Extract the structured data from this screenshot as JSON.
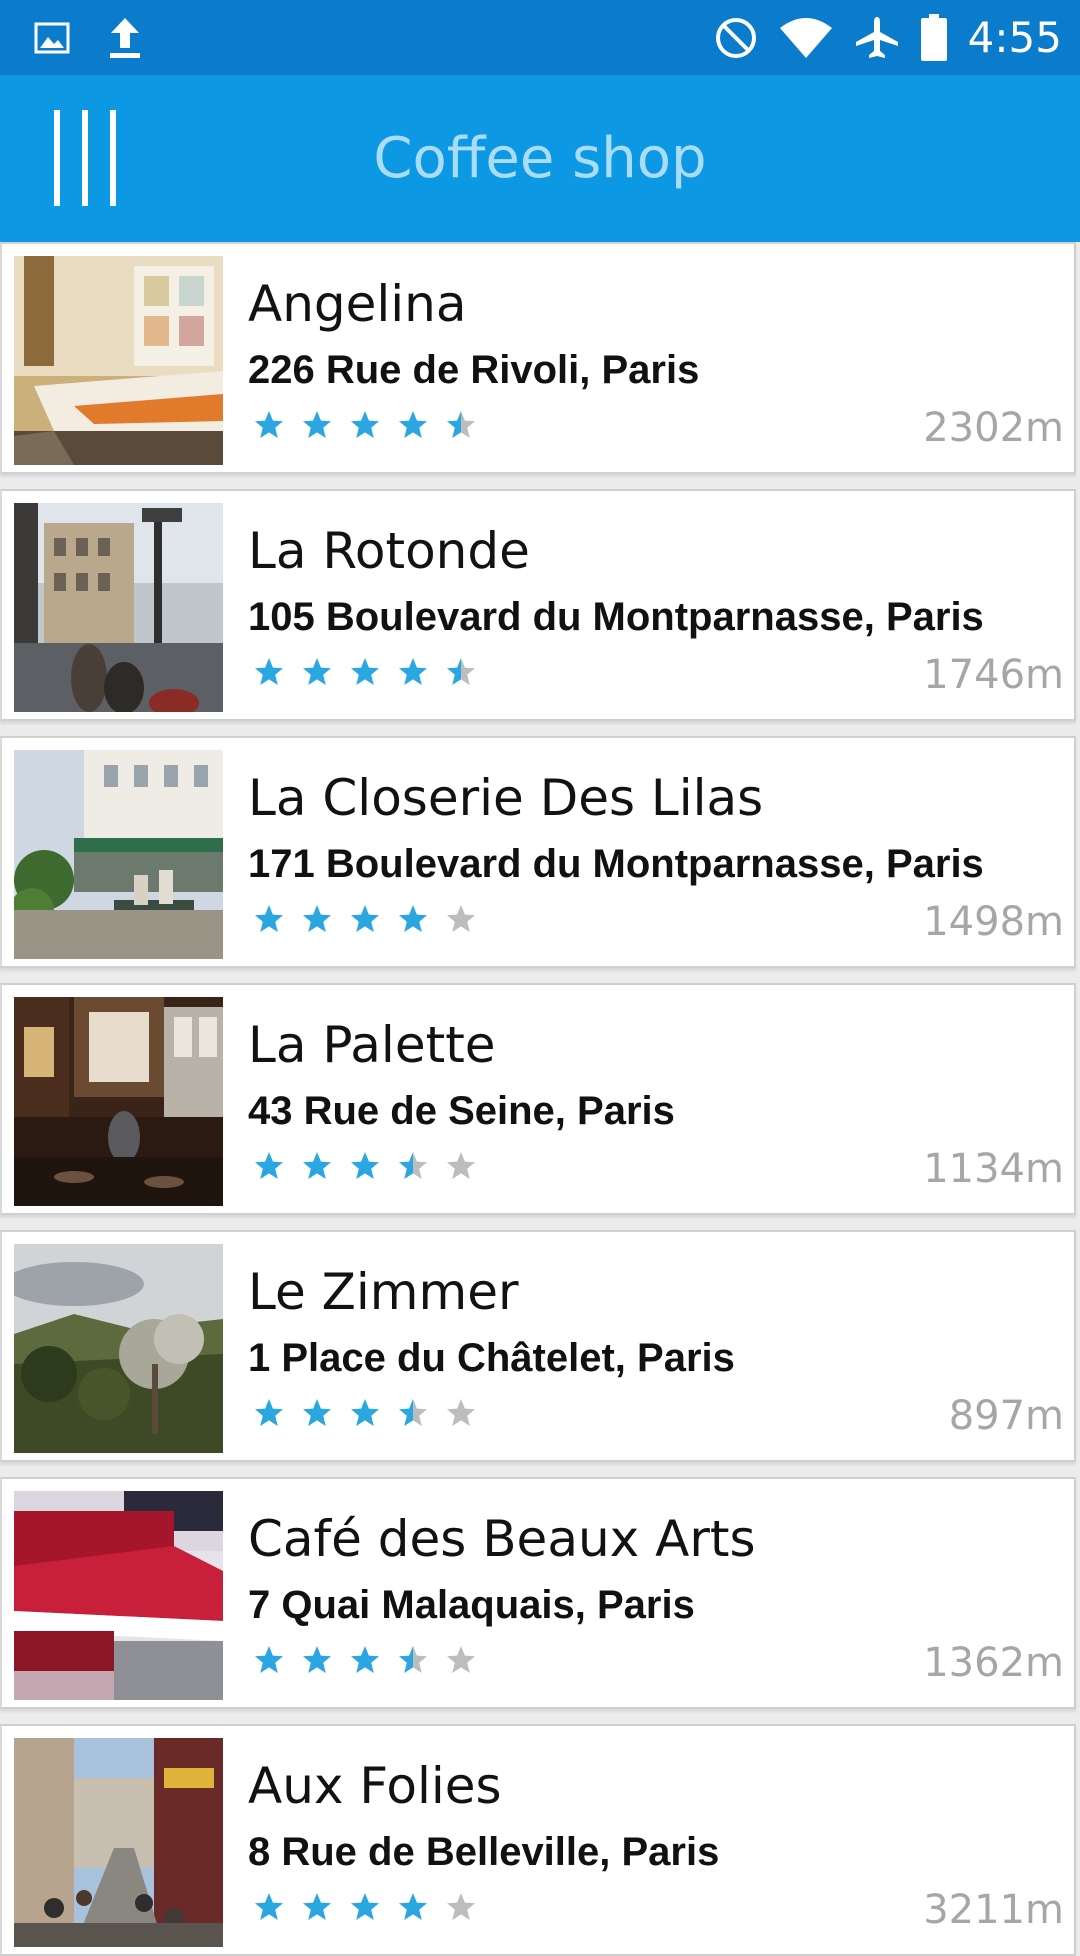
{
  "status_bar": {
    "time": "4:55",
    "left_icons": [
      "image-icon",
      "upload-icon"
    ],
    "right_icons": [
      "do-not-disturb-icon",
      "wifi-icon",
      "airplane-icon",
      "battery-icon"
    ]
  },
  "app_bar": {
    "title": "Coffee shop",
    "menu_icon": "menu-icon"
  },
  "colors": {
    "status_bar": "#0b7ccb",
    "app_bar": "#0d98e3",
    "title": "#a9dcf6",
    "star_filled": "#2aa7e0",
    "star_empty": "#bdbdbd",
    "distance": "#a6a6a6"
  },
  "shops": [
    {
      "name": "Angelina",
      "address": "226 Rue de Rivoli, Paris",
      "rating": 4.5,
      "distance": "2302m",
      "thumb": "pastry-counter"
    },
    {
      "name": "La Rotonde",
      "address": "105 Boulevard du Montparnasse, Paris",
      "rating": 4.5,
      "distance": "1746m",
      "thumb": "street-terrace"
    },
    {
      "name": "La Closerie Des Lilas",
      "address": "171 Boulevard du Montparnasse, Paris",
      "rating": 4,
      "distance": "1498m",
      "thumb": "garden-terrace"
    },
    {
      "name": "La Palette",
      "address": "43 Rue de Seine, Paris",
      "rating": 3.5,
      "distance": "1134m",
      "thumb": "bar-interior"
    },
    {
      "name": "Le Zimmer",
      "address": "1 Place du Châtelet, Paris",
      "rating": 3.5,
      "distance": "897m",
      "thumb": "hillside-trees"
    },
    {
      "name": "Café des Beaux Arts",
      "address": "7 Quai Malaquais, Paris",
      "rating": 3.5,
      "distance": "1362m",
      "thumb": "red-awning"
    },
    {
      "name": "Aux Folies",
      "address": "8 Rue de Belleville, Paris",
      "rating": 4,
      "distance": "3211m",
      "thumb": "busy-street"
    }
  ]
}
